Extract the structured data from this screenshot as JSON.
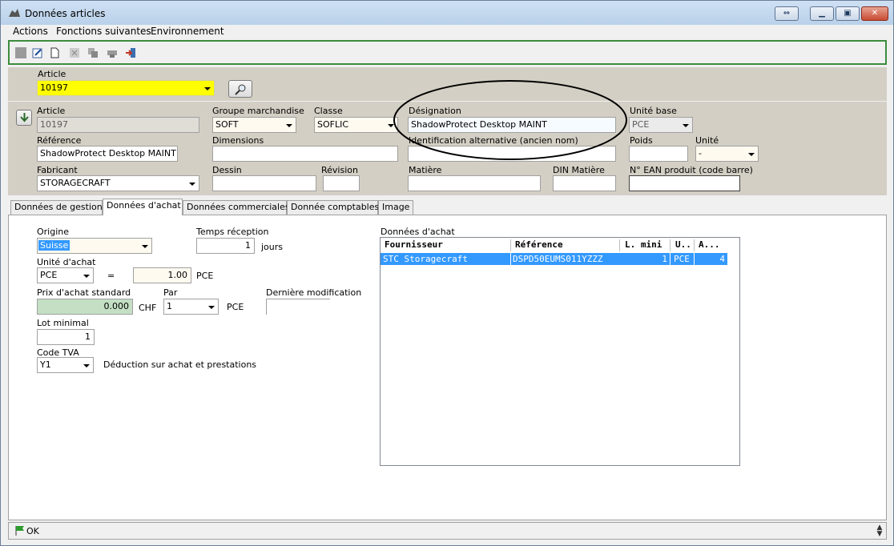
{
  "window": {
    "title": "Données articles"
  },
  "menu": [
    {
      "label": "Actions"
    },
    {
      "label": "Fonctions suivantes"
    },
    {
      "label": "Environnement"
    }
  ],
  "header": {
    "article_label": "Article",
    "article_value": "10197"
  },
  "fields": {
    "article_label": "Article",
    "article_value": "10197",
    "groupe_label": "Groupe marchandise",
    "groupe_value": "SOFT",
    "classe_label": "Classe",
    "classe_value": "SOFLIC",
    "designation_label": "Désignation",
    "designation_value": "ShadowProtect Desktop MAINT",
    "unite_base_label": "Unité base",
    "unite_base_value": "PCE",
    "reference_label": "Référence",
    "reference_value": "ShadowProtect Desktop MAINT",
    "dimensions_label": "Dimensions",
    "dimensions_value": "",
    "ident_alt_label": "Identification alternative (ancien nom)",
    "ident_alt_value": "",
    "poids_label": "Poids",
    "poids_value": "",
    "unite_label": "Unité",
    "unite_value": "-",
    "fabricant_label": "Fabricant",
    "fabricant_value": "STORAGECRAFT",
    "dessin_label": "Dessin",
    "dessin_value": "",
    "revision_label": "Révision",
    "revision_value": "",
    "matiere_label": "Matière",
    "matiere_value": "",
    "din_label": "DIN Matière",
    "din_value": "",
    "ean_label": "N° EAN produit (code barre)",
    "ean_value": ""
  },
  "tabs": [
    {
      "label": "Données de gestion"
    },
    {
      "label": "Données d'achat"
    },
    {
      "label": "Données commerciales"
    },
    {
      "label": "Donnée comptables"
    },
    {
      "label": "Image"
    }
  ],
  "achat": {
    "origine_label": "Origine",
    "origine_value": "Suisse",
    "temps_label": "Temps réception",
    "temps_value": "1",
    "temps_unit": "jours",
    "unite_achat_label": "Unité d'achat",
    "unite_achat_value": "PCE",
    "eq": "=",
    "conv_value": "1.00",
    "conv_unit": "PCE",
    "prix_label": "Prix d'achat standard",
    "prix_value": "0.000",
    "devise": "CHF",
    "par_label": "Par",
    "par_value": "1",
    "par_unit": "PCE",
    "derniere_label": "Dernière modification",
    "lot_label": "Lot minimal",
    "lot_value": "1",
    "tva_label": "Code TVA",
    "tva_value": "Y1",
    "tva_desc": "Déduction sur achat et prestations"
  },
  "grid": {
    "title": "Données d'achat",
    "columns": [
      "Fournisseur",
      "Référence",
      "L. mini",
      "U..",
      "A..."
    ],
    "rows": [
      [
        "STC Storagecraft",
        "DSPD50EUMS011YZZZ",
        "1",
        "PCE",
        "4"
      ]
    ]
  },
  "status": {
    "text": "OK"
  },
  "colors": {
    "accent_select": "#3399ff",
    "highlight_yellow": "#ffff00",
    "toolbar_border": "#3c8c3c"
  }
}
